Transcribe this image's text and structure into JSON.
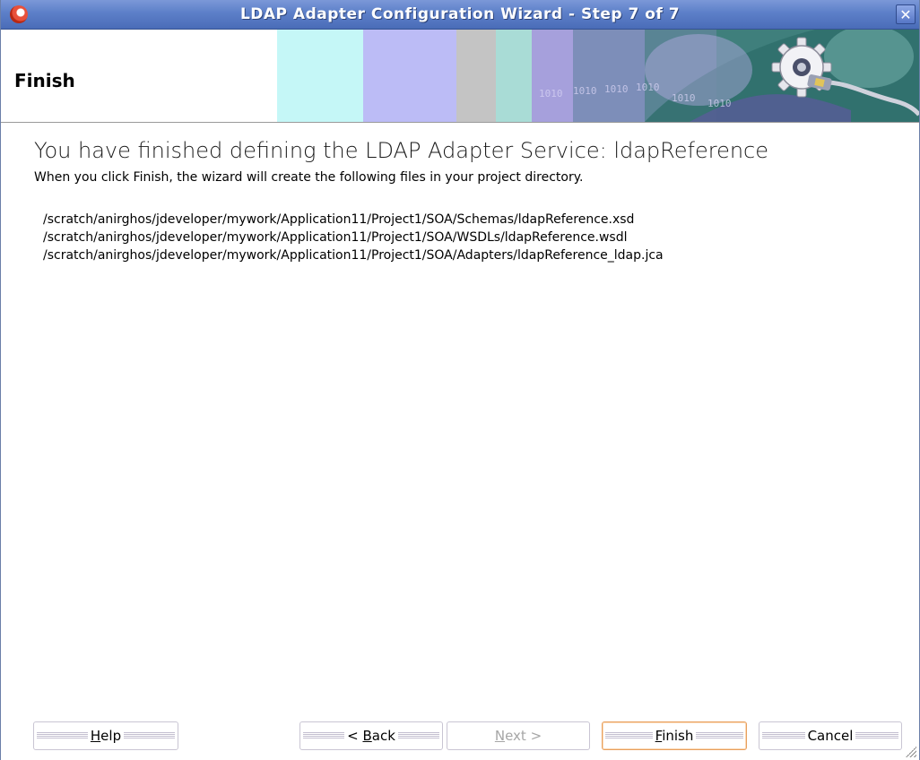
{
  "window": {
    "title": "LDAP Adapter Configuration Wizard - Step 7 of 7",
    "close_glyph": "✕"
  },
  "header": {
    "title": "Finish"
  },
  "content": {
    "headline": "You have finished defining the LDAP Adapter Service: ldapReference",
    "description": "When you click Finish, the wizard will create the following files in your project directory.",
    "files": [
      "/scratch/anirghos/jdeveloper/mywork/Application11/Project1/SOA/Schemas/ldapReference.xsd",
      "/scratch/anirghos/jdeveloper/mywork/Application11/Project1/SOA/WSDLs/ldapReference.wsdl",
      "/scratch/anirghos/jdeveloper/mywork/Application11/Project1/SOA/Adapters/ldapReference_ldap.jca"
    ]
  },
  "buttons": {
    "help": {
      "mnemonic": "H",
      "rest": "elp"
    },
    "back": {
      "prefix": "< ",
      "mnemonic": "B",
      "rest": "ack"
    },
    "next": {
      "mnemonic": "N",
      "rest": "ext >"
    },
    "finish": {
      "mnemonic": "F",
      "rest": "inish"
    },
    "cancel": {
      "label": "Cancel"
    }
  },
  "colors": {
    "titlebar": "#5c7fc8",
    "default_button_border": "#e8a05e"
  },
  "icons": {
    "app": "oracle-logo-icon",
    "close": "close-icon",
    "banner": "gear-plug-banner"
  }
}
